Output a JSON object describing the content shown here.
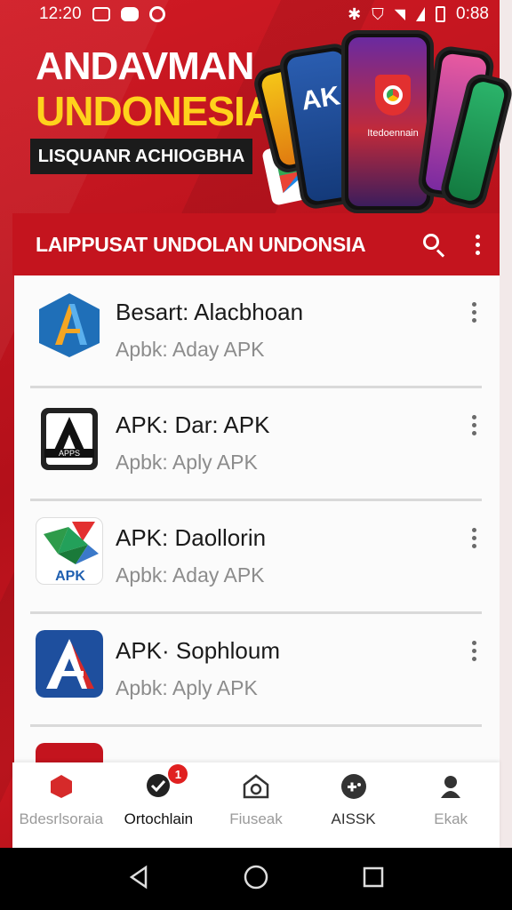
{
  "status_bar": {
    "time": "12:20",
    "battery": "0:88"
  },
  "banner": {
    "title_line1": "ANDAVMAN",
    "title_line2": "UNDONESIA",
    "subtitle": "LISQUANR ACHIOGBHA",
    "phone_text": "Itedoennain"
  },
  "app_bar": {
    "title": "LAIPPUSAT UNDOLAN UNDONSIA"
  },
  "apps": [
    {
      "name": "Besart: Alacbhoan",
      "subtitle": "Apbk: Aday APK",
      "icon": "stylized-a-icon"
    },
    {
      "name": "APK: Dar: APK",
      "subtitle": "Apbk: Aply APK",
      "icon": "apps-a-icon"
    },
    {
      "name": "APK: Daollorin",
      "subtitle": "Apbk: Aday APK",
      "icon": "apk-star-icon"
    },
    {
      "name": "APK· Sophloum",
      "subtitle": "Apbk: Aply APK",
      "icon": "blue-a-icon"
    }
  ],
  "bottom_nav": [
    {
      "label": "Bdesrlsoraia",
      "icon": "hexagon-icon"
    },
    {
      "label": "Ortochlain",
      "icon": "chat-icon",
      "badge": "1"
    },
    {
      "label": "Fiuseak",
      "icon": "house-camera-icon"
    },
    {
      "label": "AISSK",
      "icon": "gamepad-icon"
    },
    {
      "label": "Ekak",
      "icon": "person-icon"
    }
  ],
  "colors": {
    "brand_red": "#c4141e",
    "banner_yellow": "#ffd21c",
    "badge_red": "#e02020"
  }
}
